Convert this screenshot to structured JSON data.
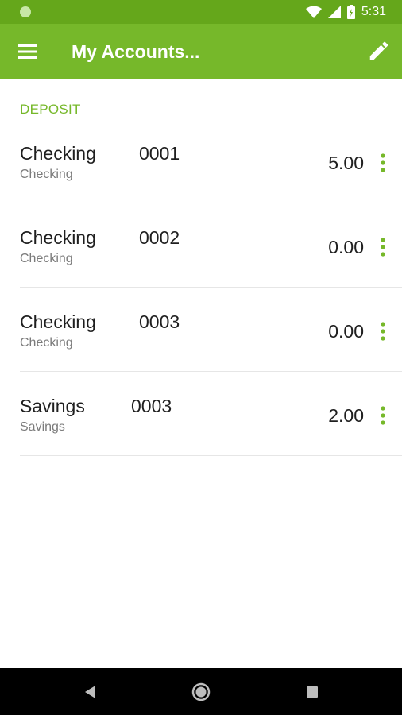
{
  "status_bar": {
    "time": "5:31",
    "icons": [
      "notification-dot-icon",
      "wifi-icon",
      "signal-icon",
      "battery-icon"
    ]
  },
  "app_bar": {
    "title": "My Accounts...",
    "menu_icon": "hamburger-menu-icon",
    "action_icon": "pencil-edit-icon"
  },
  "section": {
    "label": "DEPOSIT"
  },
  "accounts": [
    {
      "name": "Checking",
      "type": "Checking",
      "number": "0001",
      "balance": "5.00"
    },
    {
      "name": "Checking",
      "type": "Checking",
      "number": "0002",
      "balance": "0.00"
    },
    {
      "name": "Checking",
      "type": "Checking",
      "number": "0003",
      "balance": "0.00"
    },
    {
      "name": "Savings",
      "type": "Savings",
      "number": "0003",
      "balance": "2.00"
    }
  ],
  "nav_bar": {
    "icons": [
      "back-icon",
      "home-icon",
      "recents-icon"
    ]
  },
  "colors": {
    "app_bar": "#76b82a",
    "status_bar": "#65a71b",
    "accent": "#76b82a",
    "nav_bar": "#000000"
  }
}
